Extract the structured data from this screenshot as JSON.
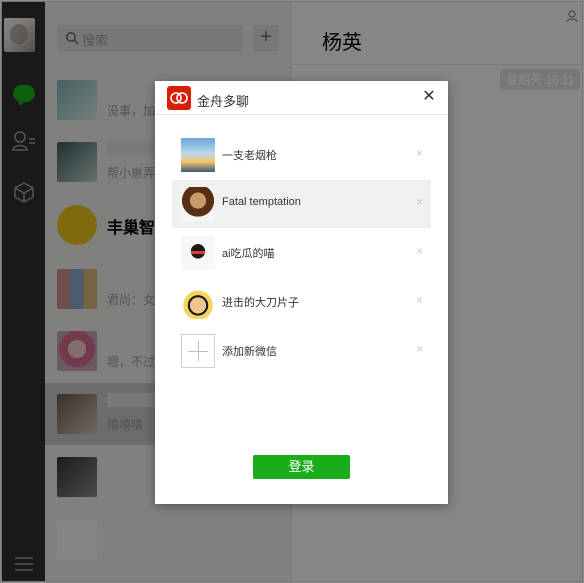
{
  "list": {
    "search_placeholder": "搜索",
    "plus_label": "+",
    "chats": [
      {
        "name": "",
        "preview": "没事，加"
      },
      {
        "name": "",
        "preview": "帮小崽弄"
      },
      {
        "name": "丰巢智能",
        "preview": ""
      },
      {
        "name": "",
        "preview": "君尚：女生"
      },
      {
        "name": "",
        "preview": "嗯，不过这"
      },
      {
        "name": "",
        "preview": "嘻嘻嘻"
      },
      {
        "name": "",
        "preview": ""
      },
      {
        "name": "",
        "preview": ""
      }
    ]
  },
  "main": {
    "title": "杨英",
    "time_tag": "星期天 18:11"
  },
  "dialog": {
    "title": "金舟多聊",
    "close": "✕",
    "accounts": [
      {
        "name": "一支老烟枪",
        "remove": "×"
      },
      {
        "name": "Fatal temptation",
        "remove": "×"
      },
      {
        "name": "ai吃瓜的喵",
        "remove": "×"
      },
      {
        "name": "进击的大刀片子",
        "remove": "×"
      }
    ],
    "add_label": "添加新微信",
    "add_remove": "×",
    "login_label": "登录"
  },
  "colors": {
    "accent_green": "#1aad19",
    "brand_red": "#d81e06",
    "sidebar_dark": "#2e2e2e"
  },
  "icons": [
    "search-icon",
    "plus-icon",
    "chat-icon",
    "contacts-icon",
    "box-icon",
    "menu-icon",
    "profile-icon",
    "app-logo-icon",
    "close-icon"
  ]
}
